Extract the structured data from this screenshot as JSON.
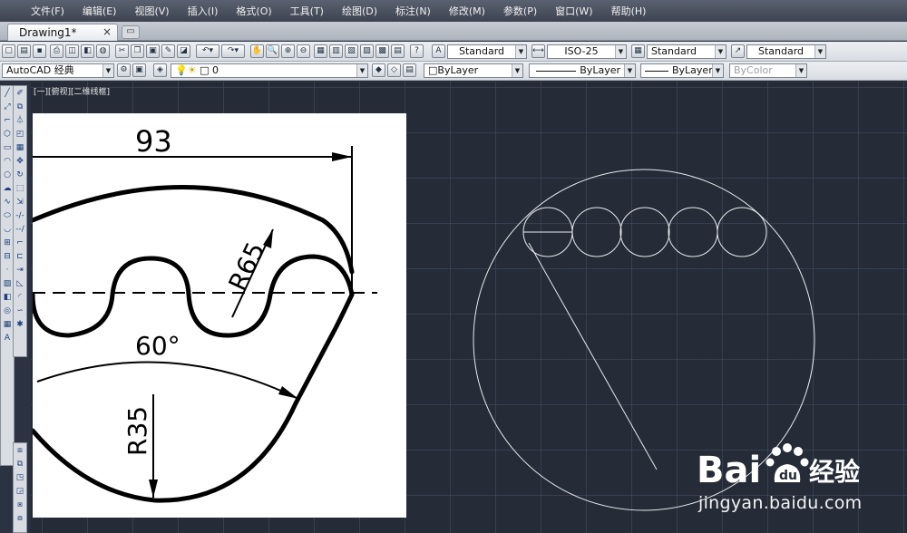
{
  "menu": [
    "文件(F)",
    "编辑(E)",
    "视图(V)",
    "插入(I)",
    "格式(O)",
    "工具(T)",
    "绘图(D)",
    "标注(N)",
    "修改(M)",
    "参数(P)",
    "窗口(W)",
    "帮助(H)"
  ],
  "tabs": {
    "document": "Drawing1*",
    "close_glyph": "×"
  },
  "styles_toolbar": {
    "text_style": "Standard",
    "dim_style": "ISO-25",
    "table_style": "Standard",
    "mleader_style": "Standard"
  },
  "layers_toolbar": {
    "workspace": "AutoCAD 经典",
    "layer": "0",
    "color": "ByLayer",
    "linetype": "ByLayer",
    "lineweight": "ByLayer",
    "plot_style": "ByColor"
  },
  "viewport": {
    "label": "[一][俯视][二维线框]"
  },
  "reference_image": {
    "dim_width": "93",
    "dim_r_large": "R65",
    "dim_angle": "60°",
    "dim_r_small": "R35"
  },
  "watermark": {
    "logo_text": "Bai",
    "logo_text2": "经验",
    "url": "jingyan.baidu.com"
  },
  "colors": {
    "viewport_bg": "#252b37",
    "cad_line": "#e8ecf0",
    "menubar": "#4a505d"
  }
}
